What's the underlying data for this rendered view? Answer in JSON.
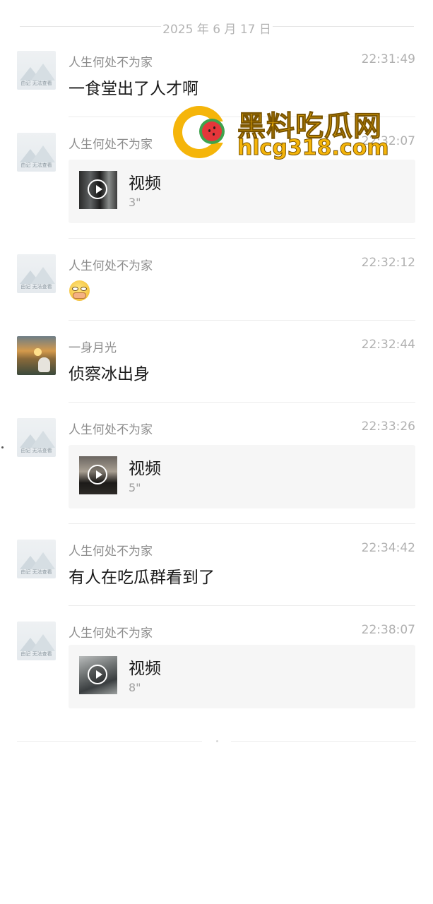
{
  "chat": {
    "date": "2025 年 6 月 17 日",
    "messages": [
      {
        "sender": "人生何处不为家",
        "time": "22:31:49",
        "type": "text",
        "text": "一食堂出了人才啊",
        "avatar_text": "由记 无法查看"
      },
      {
        "sender": "人生何处不为家",
        "time": "22:32:07",
        "type": "video",
        "video_label": "视频",
        "duration": "3\"",
        "avatar_text": "由记 无法查看"
      },
      {
        "sender": "人生何处不为家",
        "time": "22:32:12",
        "type": "emoji",
        "emoji": "face-emoji-icon",
        "avatar_text": "由记 无法查看"
      },
      {
        "sender": "一身月光",
        "time": "22:32:44",
        "type": "text",
        "text": "侦察冰出身"
      },
      {
        "sender": "人生何处不为家",
        "time": "22:33:26",
        "type": "video",
        "video_label": "视频",
        "duration": "5\"",
        "avatar_text": "由记 无法查看"
      },
      {
        "sender": "人生何处不为家",
        "time": "22:34:42",
        "type": "text",
        "text": "有人在吃瓜群看到了",
        "avatar_text": "由记 无法查看"
      },
      {
        "sender": "人生何处不为家",
        "time": "22:38:07",
        "type": "video",
        "video_label": "视频",
        "duration": "8\"",
        "avatar_text": "由记 无法查看"
      }
    ]
  },
  "watermark": {
    "title": "黑料吃瓜网",
    "url": "hlcg318.com",
    "color": "#f5b50a"
  }
}
